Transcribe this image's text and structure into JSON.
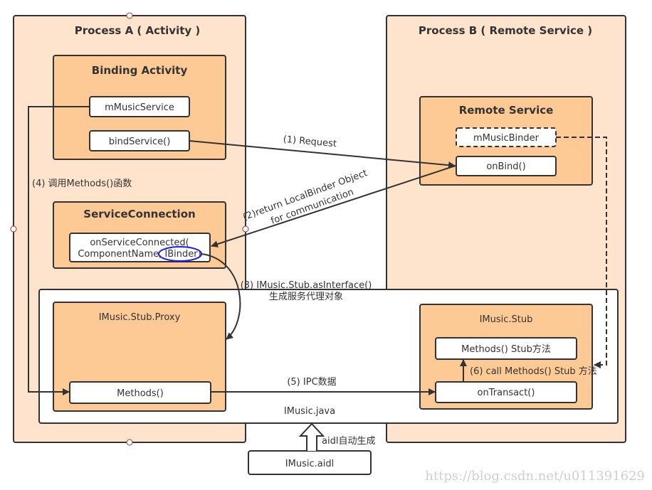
{
  "colors": {
    "process_bg": "#fee4cc",
    "inner_bg": "#fdca96",
    "box_bg": "#ffffff",
    "stroke": "#333333",
    "highlight": "#1a1aff"
  },
  "process_a": {
    "title": "Process A ( Activity )",
    "binding_activity": {
      "title": "Binding Activity",
      "field": "mMusicService",
      "method": "bindService()"
    },
    "service_connection": {
      "title": "ServiceConnection",
      "line1": "onServiceConnected(",
      "line2": "ComponentName, IBinder)"
    }
  },
  "process_b": {
    "title": "Process B ( Remote Service )",
    "remote_service": {
      "title": "Remote Service",
      "field": "mMusicBinder",
      "method": "onBind()"
    }
  },
  "imusic_java": {
    "label": "IMusic.java",
    "proxy": {
      "title": "IMusic.Stub.Proxy",
      "method": "Methods()"
    },
    "stub": {
      "title": "IMusic.Stub",
      "method": "Methods() Stub方法",
      "transact": "onTransact()"
    }
  },
  "aidl": {
    "label": "IMusic.aidl",
    "generated_label": "aidl自动生成"
  },
  "steps": {
    "s1": "(1) Request",
    "s2a": "(2)return LocalBinder Object",
    "s2b": "for communication",
    "s3a": "(3) IMusic.Stub.asInterface()",
    "s3b": "生成服务代理对象",
    "s4": "(4) 调用Methods()函数",
    "s5": "(5) IPC数据",
    "s6": "(6) call Methods() Stub 方法"
  },
  "watermark": "https://blog.csdn.net/u011391629"
}
